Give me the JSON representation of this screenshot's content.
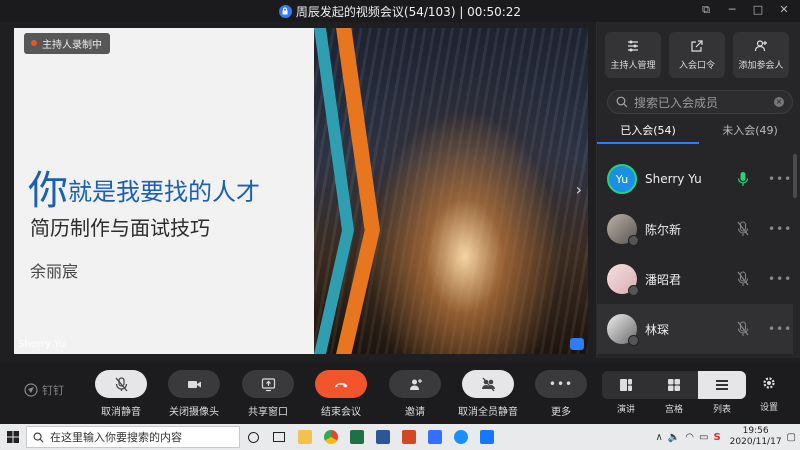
{
  "window": {
    "title": "周辰发起的视频会议(54/103) | 00:50:22"
  },
  "stage": {
    "recording_badge": "主持人录制中",
    "slide_title_first": "你",
    "slide_title_rest": "就是我要找的人才",
    "slide_subtitle": "简历制作与面试技巧",
    "slide_author": "余丽宸",
    "speaker_name": "Sherry Yu"
  },
  "panel": {
    "buttons": [
      {
        "label": "主持人管理",
        "icon": "sliders-icon"
      },
      {
        "label": "入会口令",
        "icon": "share-out-icon"
      },
      {
        "label": "添加参会人",
        "icon": "add-person-icon"
      }
    ],
    "search_placeholder": "搜索已入会成员",
    "tabs": [
      {
        "label": "已入会(54)",
        "active": true
      },
      {
        "label": "未入会(49)",
        "active": false
      }
    ],
    "members": [
      {
        "name": "Sherry Yu",
        "avatar_text": "Yu",
        "avatar_color": "#1a8fe3",
        "mic": "active",
        "selected": false
      },
      {
        "name": "陈尔新",
        "avatar_text": "",
        "avatar_color": "#8a7f78",
        "mic": "muted",
        "selected": false
      },
      {
        "name": "潘昭君",
        "avatar_text": "",
        "avatar_color": "#e9c6c9",
        "mic": "muted",
        "selected": false
      },
      {
        "name": "林琛",
        "avatar_text": "",
        "avatar_color": "#cfcfcf",
        "mic": "muted",
        "selected": true
      }
    ]
  },
  "toolbar": {
    "app_name": "钉钉",
    "buttons": [
      {
        "label": "取消静音",
        "icon": "mic-muted-icon"
      },
      {
        "label": "关闭摄像头",
        "icon": "camera-icon"
      },
      {
        "label": "共享窗口",
        "icon": "share-screen-icon"
      },
      {
        "label": "结束会议",
        "icon": "hangup-icon"
      },
      {
        "label": "邀请",
        "icon": "invite-icon"
      },
      {
        "label": "取消全员静音",
        "icon": "mute-all-icon"
      },
      {
        "label": "更多",
        "icon": "more-icon"
      }
    ],
    "views": [
      {
        "label": "演讲",
        "active": false
      },
      {
        "label": "宫格",
        "active": false
      },
      {
        "label": "列表",
        "active": true
      }
    ],
    "settings_label": "设置"
  },
  "taskbar": {
    "search_placeholder": "在这里输入你要搜索的内容",
    "time": "19:56",
    "date": "2020/11/17"
  },
  "colors": {
    "accent": "#2f7cf6",
    "end_call": "#f2552c",
    "panel_bg": "#262628"
  }
}
